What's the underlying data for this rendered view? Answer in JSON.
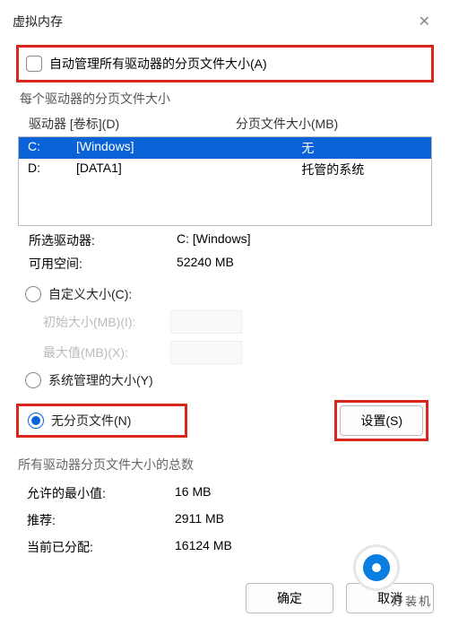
{
  "title": "虚拟内存",
  "auto_manage": {
    "label": "自动管理所有驱动器的分页文件大小(A)"
  },
  "section_each_drive": "每个驱动器的分页文件大小",
  "columns": {
    "drive": "驱动器 [卷标](D)",
    "size": "分页文件大小(MB)"
  },
  "drives": [
    {
      "letter": "C:",
      "label": "[Windows]",
      "size": "无",
      "selected": true
    },
    {
      "letter": "D:",
      "label": "[DATA1]",
      "size": "托管的系统",
      "selected": false
    }
  ],
  "selected_info": {
    "drive_label": "所选驱动器:",
    "drive_value": "C:  [Windows]",
    "free_label": "可用空间:",
    "free_value": "52240 MB"
  },
  "options": {
    "custom": "自定义大小(C):",
    "initial": "初始大小(MB)(I):",
    "max": "最大值(MB)(X):",
    "system": "系统管理的大小(Y)",
    "none": "无分页文件(N)",
    "set_button": "设置(S)"
  },
  "totals_label": "所有驱动器分页文件大小的总数",
  "totals": {
    "min_label": "允许的最小值:",
    "min_value": "16 MB",
    "rec_label": "推荐:",
    "rec_value": "2911 MB",
    "cur_label": "当前已分配:",
    "cur_value": "16124 MB"
  },
  "footer": {
    "ok": "确定",
    "cancel": "取消"
  },
  "brand": "好装机"
}
